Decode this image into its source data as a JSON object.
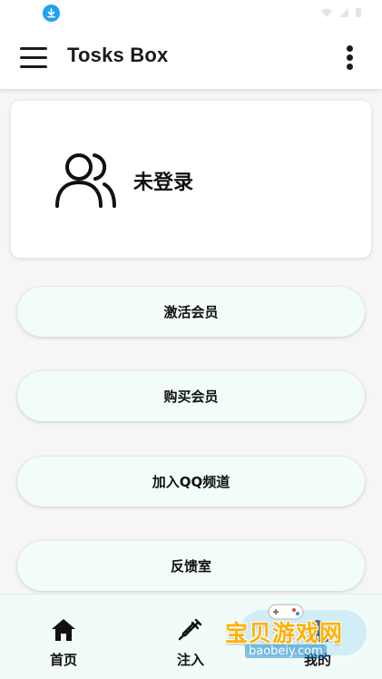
{
  "app_bar": {
    "title": "Tosks Box",
    "menu_icon": "hamburger-menu-icon",
    "more_icon": "more-vertical-icon"
  },
  "status_bar": {
    "download_icon": "download-icon",
    "download_color": "#1ea1f2"
  },
  "profile": {
    "status_text": "未登录",
    "avatar_icon": "users-icon"
  },
  "actions": [
    {
      "label": "激活会员"
    },
    {
      "label": "购买会员"
    },
    {
      "label": "加入QQ频道"
    },
    {
      "label": "反馈室"
    }
  ],
  "bottom_nav": [
    {
      "label": "首页",
      "icon": "home-icon"
    },
    {
      "label": "注入",
      "icon": "syringe-icon"
    },
    {
      "label": "我的",
      "icon": "user-icon"
    }
  ],
  "watermark": {
    "text": "宝贝游戏网",
    "sub": "baobeiy.com",
    "color": "#ffb000"
  },
  "colors": {
    "background": "#f6f6f6",
    "pill_fill": "#f2fdfb",
    "nav_fill": "#f1fbfa"
  }
}
